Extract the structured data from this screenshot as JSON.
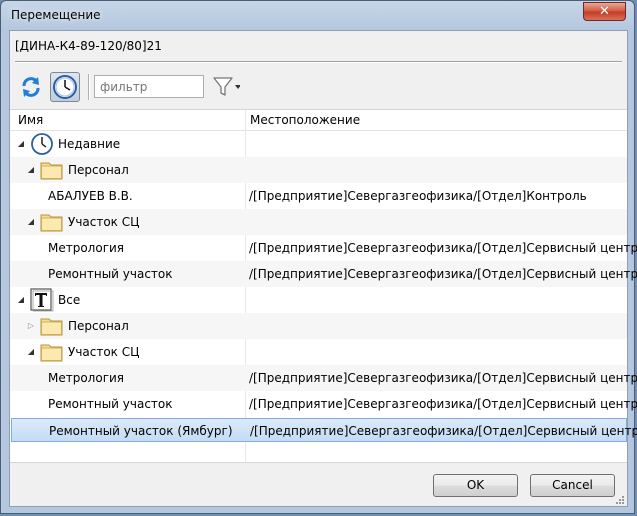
{
  "window": {
    "title": "Перемещение",
    "close_label": "✕"
  },
  "document_label": "[ДИНА-К4-89-120/80]21",
  "toolbar": {
    "filter_placeholder": "фильтр"
  },
  "table": {
    "headers": {
      "name": "Имя",
      "location": "Местоположение"
    },
    "rows": [
      {
        "name": "Недавние",
        "location": ""
      },
      {
        "name": "Персонал",
        "location": ""
      },
      {
        "name": "АБАЛУЕВ В.В.",
        "location": "/[Предприятие]Севергазгеофизика/[Отдел]Контроль"
      },
      {
        "name": "Участок СЦ",
        "location": ""
      },
      {
        "name": "Метрология",
        "location": "/[Предприятие]Севергазгеофизика/[Отдел]Сервисный центр"
      },
      {
        "name": "Ремонтный участок",
        "location": "/[Предприятие]Севергазгеофизика/[Отдел]Сервисный центр"
      },
      {
        "name": "Все",
        "location": ""
      },
      {
        "name": "Персонал",
        "location": ""
      },
      {
        "name": "Участок СЦ",
        "location": ""
      },
      {
        "name": "Метрология",
        "location": "/[Предприятие]Севергазгеофизика/[Отдел]Сервисный центр"
      },
      {
        "name": "Ремонтный участок",
        "location": "/[Предприятие]Севергазгеофизика/[Отдел]Сервисный центр"
      },
      {
        "name": "Ремонтный участок (Ямбург)",
        "location": "/[Предприятие]Севергазгеофизика/[Отдел]Сервисный центр"
      }
    ]
  },
  "buttons": {
    "ok": "OK",
    "cancel": "Cancel"
  },
  "icons": [
    "refresh-icon",
    "clock-icon",
    "filter-icon",
    "folder-icon",
    "text-type-icon",
    "expanded-arrow-icon",
    "collapsed-arrow-icon"
  ],
  "colors": {
    "selection": "#c3dcf6",
    "selection_border": "#84acdd",
    "folder": "#f6dc8c"
  }
}
